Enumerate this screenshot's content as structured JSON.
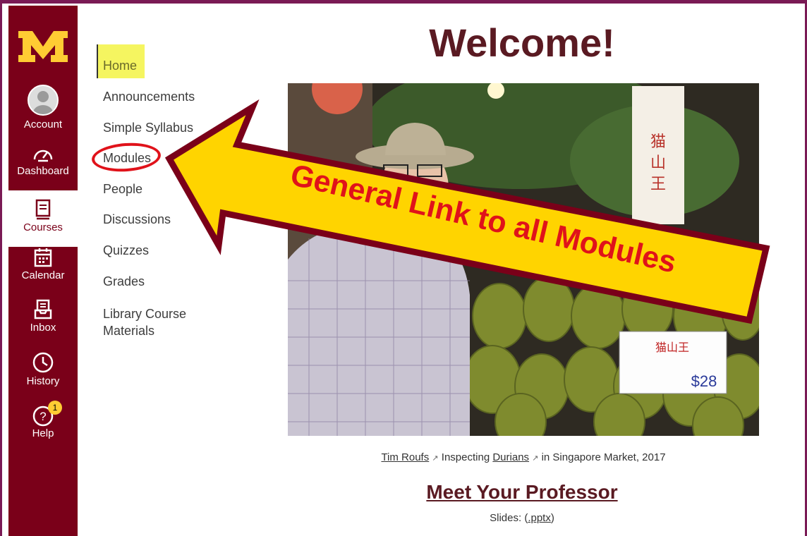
{
  "global_nav": {
    "items": [
      {
        "label": "Account",
        "icon": "user-avatar-icon"
      },
      {
        "label": "Dashboard",
        "icon": "dashboard-gauge-icon"
      },
      {
        "label": "Courses",
        "icon": "book-icon",
        "active": true
      },
      {
        "label": "Calendar",
        "icon": "calendar-icon"
      },
      {
        "label": "Inbox",
        "icon": "inbox-icon"
      },
      {
        "label": "History",
        "icon": "clock-icon"
      },
      {
        "label": "Help",
        "icon": "help-icon",
        "badge": "1"
      }
    ]
  },
  "course_nav": {
    "items": [
      {
        "label": "Home"
      },
      {
        "label": "Announcements"
      },
      {
        "label": "Simple Syllabus"
      },
      {
        "label": "Modules"
      },
      {
        "label": "People"
      },
      {
        "label": "Discussions"
      },
      {
        "label": "Quizzes"
      },
      {
        "label": "Grades"
      },
      {
        "label": "Library Course",
        "label2": "Materials"
      }
    ]
  },
  "main": {
    "title": "Welcome!",
    "caption": {
      "name": "Tim Roufs",
      "mid": " Inspecting ",
      "link": "Durians",
      "tail": " in Singapore Market, 2017"
    },
    "meet": "Meet Your Professor",
    "slides_prefix": "Slides: (",
    "slides_link": ".pptx",
    "slides_suffix": ")"
  },
  "annotation": {
    "arrow_text": "General Link to all Modules"
  },
  "colors": {
    "nav_maroon": "#7a0019",
    "gold": "#ffcc33",
    "arrow_fill": "#ffd400",
    "arrow_text": "#e0121a",
    "heading": "#5a1a22"
  }
}
